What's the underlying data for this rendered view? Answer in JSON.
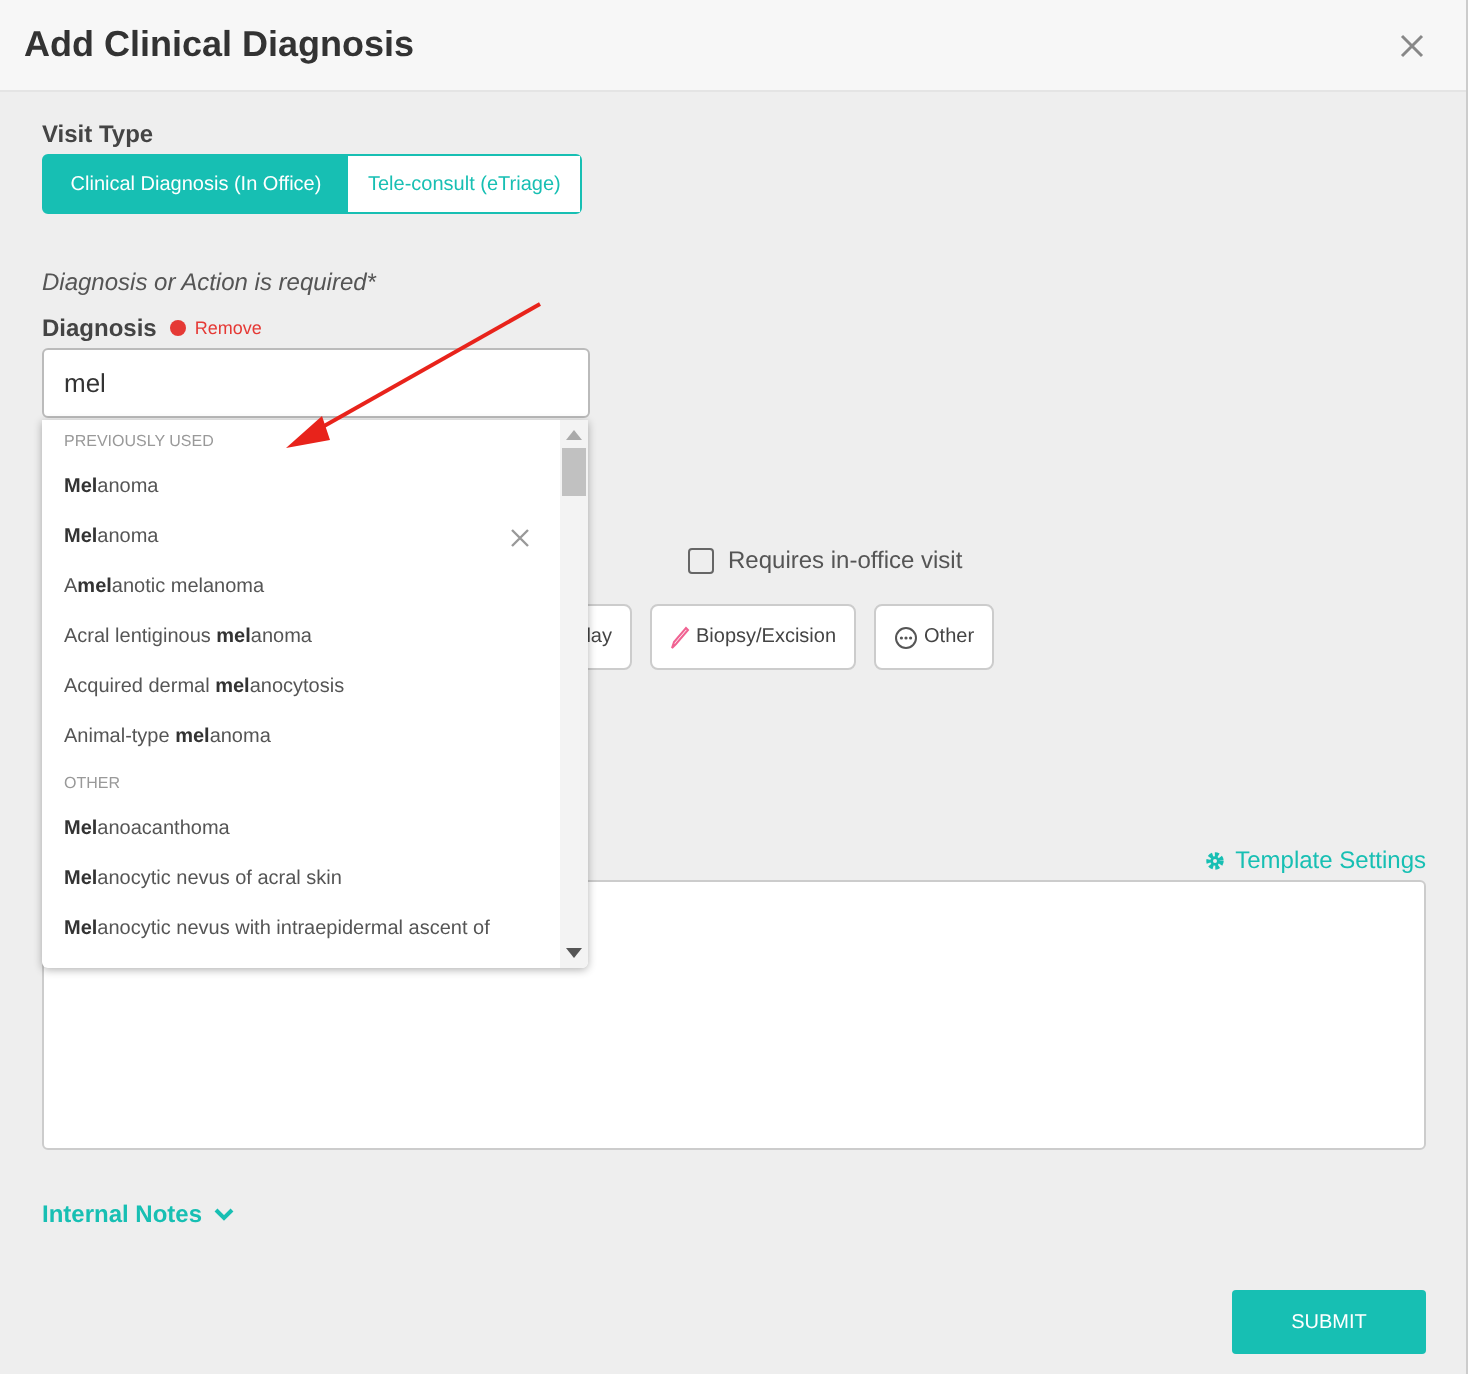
{
  "dialog": {
    "title": "Add Clinical Diagnosis"
  },
  "visit_type": {
    "label": "Visit Type",
    "options": [
      {
        "label": "Clinical Diagnosis (In Office)",
        "selected": true
      },
      {
        "label": "Tele-consult (eTriage)",
        "selected": false
      }
    ]
  },
  "required_note": "Diagnosis or Action is required*",
  "diagnosis": {
    "label": "Diagnosis",
    "remove_label": "Remove",
    "value": "mel"
  },
  "suggestions": [
    {
      "kind": "header",
      "text": "PREVIOUSLY USED"
    },
    {
      "kind": "option",
      "text": "**Mel**anoma",
      "removable": false
    },
    {
      "kind": "option",
      "text": "**Mel**anoma",
      "removable": true
    },
    {
      "kind": "option",
      "text": "A**mel**anotic melanoma",
      "removable": false
    },
    {
      "kind": "option",
      "text": "Acral lentiginous **mel**anoma",
      "removable": false
    },
    {
      "kind": "option",
      "text": "Acquired dermal **mel**anocytosis",
      "removable": false
    },
    {
      "kind": "option",
      "text": "Animal-type **mel**anoma",
      "removable": false
    },
    {
      "kind": "header",
      "text": "OTHER"
    },
    {
      "kind": "option",
      "text": "**Mel**anoacanthoma",
      "removable": false
    },
    {
      "kind": "option",
      "text": "**Mel**anocytic nevus of acral skin",
      "removable": false
    },
    {
      "kind": "option",
      "text": "**Mel**anocytic nevus with intraepidermal ascent of",
      "removable": false
    }
  ],
  "requires_in_office": {
    "label": "Requires in-office visit",
    "checked": false
  },
  "actions": [
    {
      "kind": "partial",
      "label": "lay"
    },
    {
      "kind": "biopsy",
      "label": "Biopsy/Excision"
    },
    {
      "kind": "other",
      "label": "Other"
    }
  ],
  "template_settings": "Template Settings",
  "internal_notes": "Internal Notes",
  "submit": "SUBMIT"
}
